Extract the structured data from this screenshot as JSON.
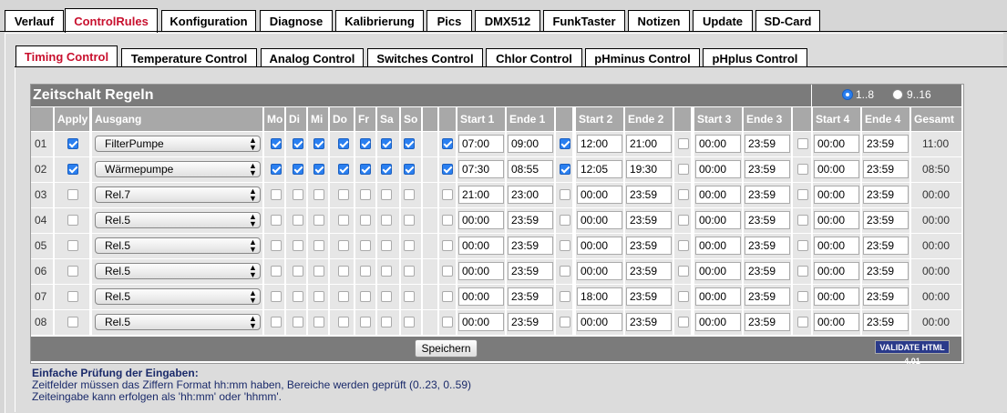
{
  "main_tabs": [
    "Verlauf",
    "ControlRules",
    "Konfiguration",
    "Diagnose",
    "Kalibrierung",
    "Pics",
    "DMX512",
    "FunkTaster",
    "Notizen",
    "Update",
    "SD-Card"
  ],
  "sub_tabs": [
    "Timing Control",
    "Temperature Control",
    "Analog Control",
    "Switches Control",
    "Chlor Control",
    "pHminus Control",
    "pHplus Control"
  ],
  "section_title": "Zeitschalt Regeln",
  "range_options": [
    "1..8",
    "9..16"
  ],
  "headers": {
    "apply": "Apply",
    "ausgang": "Ausgang",
    "days": [
      "Mo",
      "Di",
      "Mi",
      "Do",
      "Fr",
      "Sa",
      "So"
    ],
    "start1": "Start 1",
    "ende1": "Ende 1",
    "start2": "Start 2",
    "ende2": "Ende 2",
    "start3": "Start 3",
    "ende3": "Ende 3",
    "start4": "Start 4",
    "ende4": "Ende 4",
    "gesamt": "Gesamt"
  },
  "rows": [
    {
      "num": "01",
      "apply": true,
      "ausgang": "FilterPumpe",
      "days": [
        true,
        true,
        true,
        true,
        true,
        true,
        true
      ],
      "en1": true,
      "s1": "07:00",
      "e1": "09:00",
      "en2": true,
      "s2": "12:00",
      "e2": "21:00",
      "en3": false,
      "s3": "00:00",
      "e3": "23:59",
      "en4": false,
      "s4": "00:00",
      "e4": "23:59",
      "total": "11:00"
    },
    {
      "num": "02",
      "apply": true,
      "ausgang": "Wärmepumpe",
      "days": [
        true,
        true,
        true,
        true,
        true,
        true,
        true
      ],
      "en1": true,
      "s1": "07:30",
      "e1": "08:55",
      "en2": true,
      "s2": "12:05",
      "e2": "19:30",
      "en3": false,
      "s3": "00:00",
      "e3": "23:59",
      "en4": false,
      "s4": "00:00",
      "e4": "23:59",
      "total": "08:50"
    },
    {
      "num": "03",
      "apply": false,
      "ausgang": "Rel.7",
      "days": [
        false,
        false,
        false,
        false,
        false,
        false,
        false
      ],
      "en1": false,
      "s1": "21:00",
      "e1": "23:00",
      "en2": false,
      "s2": "00:00",
      "e2": "23:59",
      "en3": false,
      "s3": "00:00",
      "e3": "23:59",
      "en4": false,
      "s4": "00:00",
      "e4": "23:59",
      "total": "00:00"
    },
    {
      "num": "04",
      "apply": false,
      "ausgang": "Rel.5",
      "days": [
        false,
        false,
        false,
        false,
        false,
        false,
        false
      ],
      "en1": false,
      "s1": "00:00",
      "e1": "23:59",
      "en2": false,
      "s2": "00:00",
      "e2": "23:59",
      "en3": false,
      "s3": "00:00",
      "e3": "23:59",
      "en4": false,
      "s4": "00:00",
      "e4": "23:59",
      "total": "00:00"
    },
    {
      "num": "05",
      "apply": false,
      "ausgang": "Rel.5",
      "days": [
        false,
        false,
        false,
        false,
        false,
        false,
        false
      ],
      "en1": false,
      "s1": "00:00",
      "e1": "23:59",
      "en2": false,
      "s2": "00:00",
      "e2": "23:59",
      "en3": false,
      "s3": "00:00",
      "e3": "23:59",
      "en4": false,
      "s4": "00:00",
      "e4": "23:59",
      "total": "00:00"
    },
    {
      "num": "06",
      "apply": false,
      "ausgang": "Rel.5",
      "days": [
        false,
        false,
        false,
        false,
        false,
        false,
        false
      ],
      "en1": false,
      "s1": "00:00",
      "e1": "23:59",
      "en2": false,
      "s2": "00:00",
      "e2": "23:59",
      "en3": false,
      "s3": "00:00",
      "e3": "23:59",
      "en4": false,
      "s4": "00:00",
      "e4": "23:59",
      "total": "00:00"
    },
    {
      "num": "07",
      "apply": false,
      "ausgang": "Rel.5",
      "days": [
        false,
        false,
        false,
        false,
        false,
        false,
        false
      ],
      "en1": false,
      "s1": "00:00",
      "e1": "23:59",
      "en2": false,
      "s2": "18:00",
      "e2": "23:59",
      "en3": false,
      "s3": "00:00",
      "e3": "23:59",
      "en4": false,
      "s4": "00:00",
      "e4": "23:59",
      "total": "00:00"
    },
    {
      "num": "08",
      "apply": false,
      "ausgang": "Rel.5",
      "days": [
        false,
        false,
        false,
        false,
        false,
        false,
        false
      ],
      "en1": false,
      "s1": "00:00",
      "e1": "23:59",
      "en2": false,
      "s2": "00:00",
      "e2": "23:59",
      "en3": false,
      "s3": "00:00",
      "e3": "23:59",
      "en4": false,
      "s4": "00:00",
      "e4": "23:59",
      "total": "00:00"
    }
  ],
  "save_label": "Speichern",
  "badge_text": "VALIDATE HTML 4.01",
  "notes": {
    "title": "Einfache Prüfung der Eingaben:",
    "line1": "Zeitfelder müssen das Ziffern Format hh:mm haben, Bereiche werden geprüft (0..23, 0..59)",
    "line2": "Zeiteingabe kann erfolgen als 'hh:mm' oder 'hhmm'."
  },
  "colors": {
    "accent": "#c8102e",
    "check": "#2a7ff0",
    "header_bg": "#7b7b7b"
  }
}
